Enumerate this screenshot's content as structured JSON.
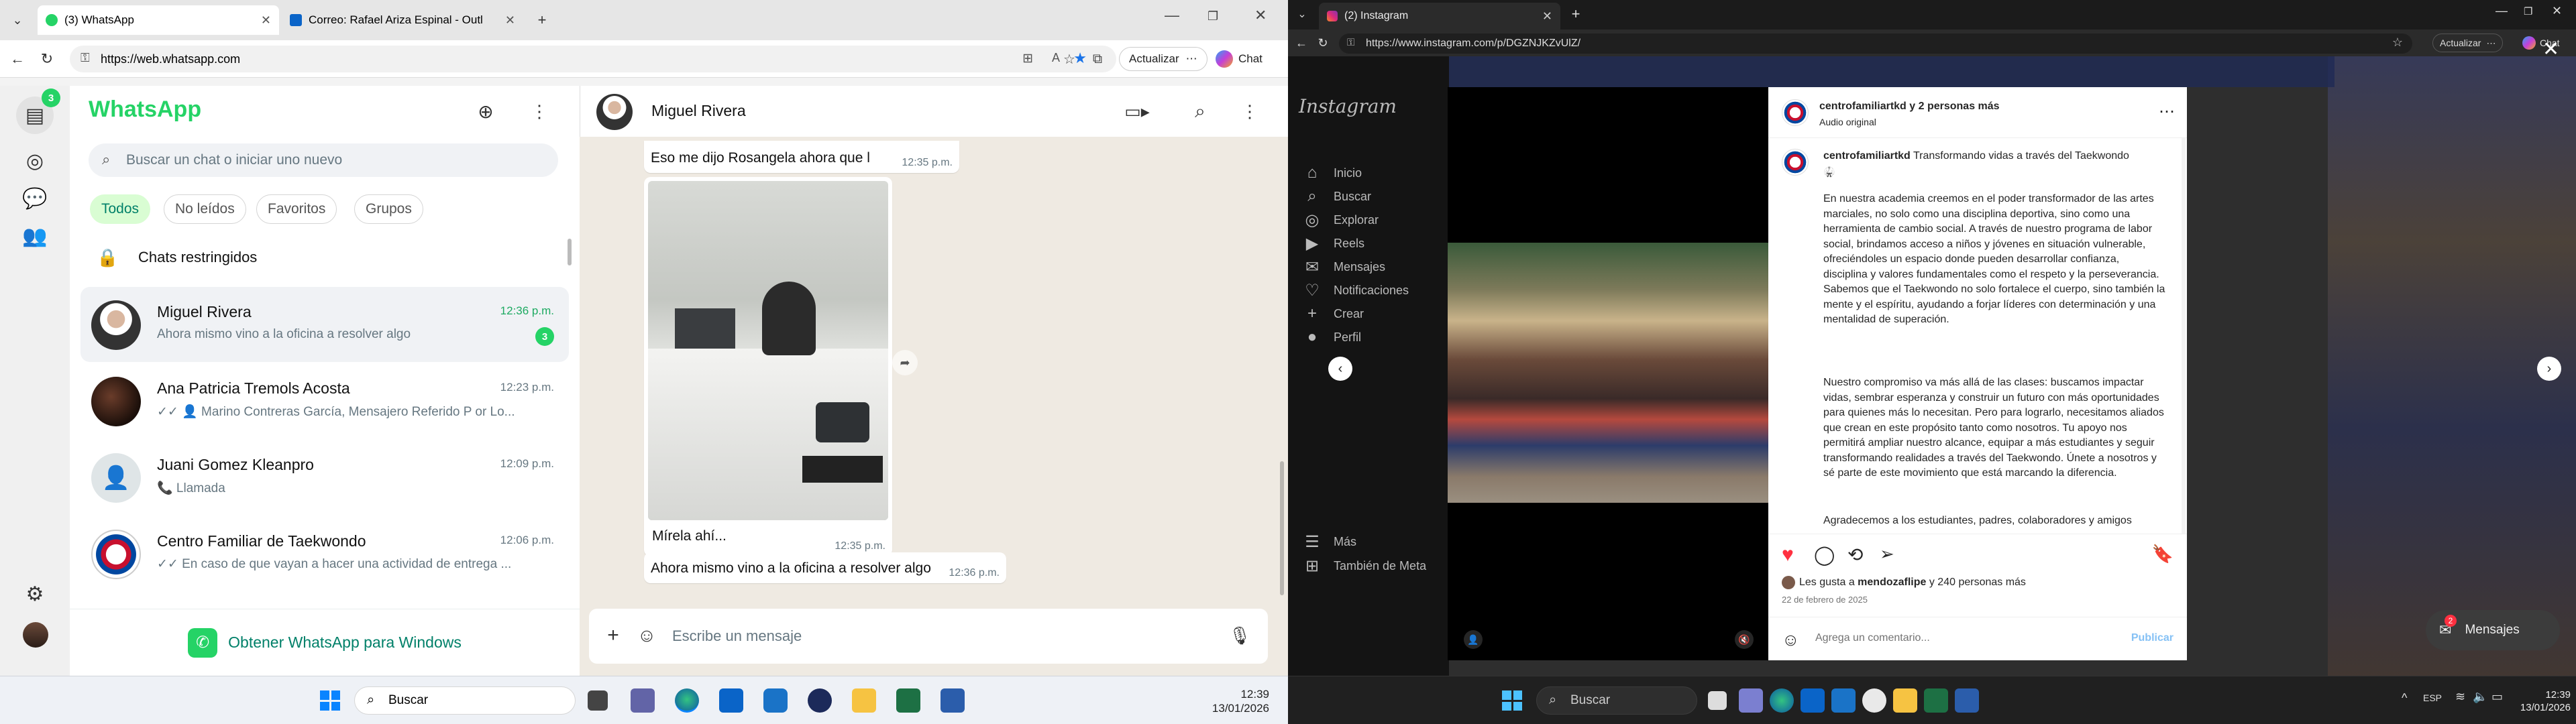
{
  "left_window": {
    "tabs": [
      {
        "label": "(3) WhatsApp",
        "active": true
      },
      {
        "label": "Correo: Rafael Ariza Espinal - Outl",
        "active": false
      }
    ],
    "url": "https://web.whatsapp.com",
    "update_label": "Actualizar",
    "chat_label": "Chat",
    "whatsapp": {
      "brand": "WhatsApp",
      "brand_color": "#25d366",
      "rail_badge": "3",
      "search_placeholder": "Buscar un chat o iniciar uno nuevo",
      "filters": [
        "Todos",
        "No leídos",
        "Favoritos",
        "Grupos"
      ],
      "restricted_label": "Chats restringidos",
      "chats": [
        {
          "name": "Miguel Rivera",
          "time": "12:36 p.m.",
          "preview": "Ahora mismo vino a la oficina a resolver algo",
          "unread": "3"
        },
        {
          "name": "Ana Patricia Tremols Acosta",
          "time": "12:23 p.m.",
          "preview": "✓✓ 👤 Marino Contreras García, Mensajero Referido P or Lo..."
        },
        {
          "name": "Juani Gomez Kleanpro",
          "time": "12:09 p.m.",
          "preview": "📞 Llamada"
        },
        {
          "name": "Centro Familiar de Taekwondo",
          "time": "12:06 p.m.",
          "preview": "✓✓ En caso de que vayan a hacer una actividad de entrega ..."
        }
      ],
      "get_app_label": "Obtener WhatsApp para Windows",
      "conversation": {
        "contact": "Miguel Rivera",
        "messages": [
          {
            "text": "Eso me dijo Rosangela ahora que la Vi",
            "time": "12:35 p.m."
          },
          {
            "caption": "Mírela ahí...",
            "time": "12:35 p.m."
          },
          {
            "text": "Ahora mismo vino a la oficina a resolver algo",
            "time": "12:36 p.m."
          }
        ],
        "composer_placeholder": "Escribe un mensaje"
      }
    },
    "taskbar": {
      "search": "Buscar",
      "time": "12:39",
      "date": "13/01/2026"
    }
  },
  "right_window": {
    "tabs": [
      {
        "label": "(2) Instagram",
        "active": true
      }
    ],
    "url": "https://www.instagram.com/p/DGZNJKZvUlZ/",
    "update_label": "Actualizar",
    "chat_label": "Chat",
    "instagram": {
      "logo": "Instagram",
      "nav": [
        {
          "label": "Inicio",
          "icon": "home-icon"
        },
        {
          "label": "Buscar",
          "icon": "search-icon"
        },
        {
          "label": "Explorar",
          "icon": "compass-icon"
        },
        {
          "label": "Reels",
          "icon": "reels-icon"
        },
        {
          "label": "Mensajes",
          "icon": "messenger-icon"
        },
        {
          "label": "Notificaciones",
          "icon": "heart-icon"
        },
        {
          "label": "Crear",
          "icon": "plus-icon"
        },
        {
          "label": "Perfil",
          "icon": "profile-icon"
        },
        {
          "label": "Más",
          "icon": "menu-icon"
        },
        {
          "label": "También de Meta",
          "icon": "meta-icon"
        }
      ],
      "post": {
        "author_line": "centrofamiliartkd y 2 personas más",
        "author_link": "centrofamiliartkd",
        "author_rest": " y 2 personas más",
        "audio": "Audio original",
        "caption_user": "centrofamiliartkd",
        "caption_title": "Transformando vidas a través del Taekwondo",
        "p1": "En nuestra academia creemos en el poder transformador de las artes marciales, no solo como una disciplina deportiva, sino como una herramienta de cambio social. A través de nuestro programa de labor social, brindamos acceso a niños y jóvenes en situación vulnerable, ofreciéndoles un espacio donde pueden desarrollar confianza, disciplina y valores fundamentales como el respeto y la perseverancia. Sabemos que el Taekwondo no solo fortalece el cuerpo, sino también la mente y el espíritu, ayudando a forjar líderes con determinación y una mentalidad de superación.",
        "p2": "Nuestro compromiso va más allá de las clases: buscamos impactar vidas, sembrar esperanza y construir un futuro con más oportunidades para quienes más lo necesitan. Pero para lograrlo, necesitamos aliados que crean en este propósito tanto como nosotros. Tu apoyo nos permitirá ampliar nuestro alcance, equipar a más estudiantes y seguir transformando realidades a través del Taekwondo. Únete a nosotros y sé parte de este movimiento que está marcando la diferencia.",
        "p3": "Agradecemos a los estudiantes, padres, colaboradores y amigos",
        "likes_prefix": "Les gusta a ",
        "likes_user": "mendozaflipe",
        "likes_suffix": " y 240 personas más",
        "date": "22 de febrero de 2025",
        "comment_placeholder": "Agrega un comentario...",
        "publish": "Publicar",
        "liked_color": "#ff3040"
      },
      "messages_pill": "Mensajes",
      "messages_badge": "2"
    },
    "taskbar": {
      "search": "Buscar",
      "lang": "ESP",
      "time": "12:39",
      "date": "13/01/2026"
    }
  }
}
